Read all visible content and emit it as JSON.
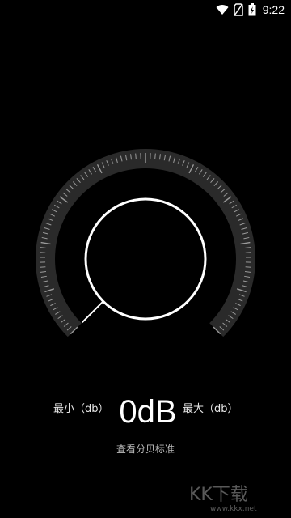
{
  "status_bar": {
    "time": "9:22",
    "icons": [
      "wifi-icon",
      "no-sim-icon",
      "battery-charging-icon"
    ]
  },
  "meter": {
    "value": "0",
    "unit": "dB",
    "min_label": "最小（db）",
    "max_label": "最大（db）",
    "needle_level": 0
  },
  "link": {
    "standard_label": "查看分贝标准"
  },
  "watermark": {
    "text": "KK下载",
    "site": "www.kkx.net"
  },
  "colors": {
    "background": "#000000",
    "dial_band": "#2a2a2a",
    "tick": "#9a9a9a",
    "knob_ring": "#ffffff"
  }
}
